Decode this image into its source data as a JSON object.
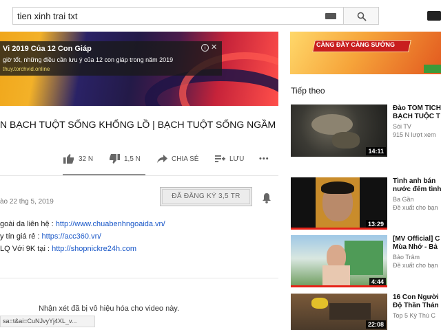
{
  "search": {
    "query": "tien xinh trai txt"
  },
  "ad_overlay": {
    "title": "Vi 2019 Của 12 Con Giáp",
    "body": "giờ tốt, những điều cần lưu ý của 12 con giáp trong năm 2019",
    "url": "thuy.torchvid.online"
  },
  "video": {
    "title": "N BẠCH TUỘT SỐNG KHỔNG LỒ | BẠCH TUỘT SỐNG NGẦM",
    "likes": "32 N",
    "dislikes": "1,5 N",
    "share_label": "CHIA SẺ",
    "save_label": "LƯU",
    "more_label": "•••"
  },
  "channel": {
    "published": "ào 22 thg 5, 2019",
    "subscribe_label": "ĐÃ ĐĂNG KÝ  3,5 TR"
  },
  "description": {
    "line1_prefix": "goài da liên hệ : ",
    "line1_link": "http://www.chuabenhngoaida.vn/",
    "line2_prefix": "y tín giá rẻ : ",
    "line2_link": "https://acc360.vn/",
    "line3_prefix": "LQ Với 9K tại : ",
    "line3_link": "http://shopnickre24h.com"
  },
  "comments": {
    "disabled_text": "Nhận xét đã bị vô hiệu hóa cho video này."
  },
  "status_bar": {
    "url": "sa=t&ai=CuNJvyYj4XL_v..."
  },
  "sidebar": {
    "banner_text": "CÀNG ĐẦY CÀNG SƯỚNG",
    "next_label": "Tiếp theo",
    "items": [
      {
        "title": "Đào TÔM TÍCH",
        "title2": "BẠCH TUỘC T",
        "channel": "Sói TV",
        "meta": "915 N lượt xem",
        "duration": "14:11"
      },
      {
        "title": "Tình anh bán",
        "title2": "nước đêm tình",
        "channel": "Ba Gần",
        "meta": "Đề xuất cho bạn",
        "duration": "13:29"
      },
      {
        "title": "[MV Official] C",
        "title2": "Mùa Nhớ - Bả",
        "channel": "Bảo Trâm",
        "meta": "Đề xuất cho bạn",
        "duration": "4:44"
      },
      {
        "title": "16 Con Người",
        "title2": "Độ Thần Thán",
        "channel": "Top 5 Kỳ Thú C",
        "meta": "",
        "duration": "22:08"
      }
    ]
  },
  "colors": {
    "link": "#1a58c8",
    "progress_red": "#e62117"
  }
}
